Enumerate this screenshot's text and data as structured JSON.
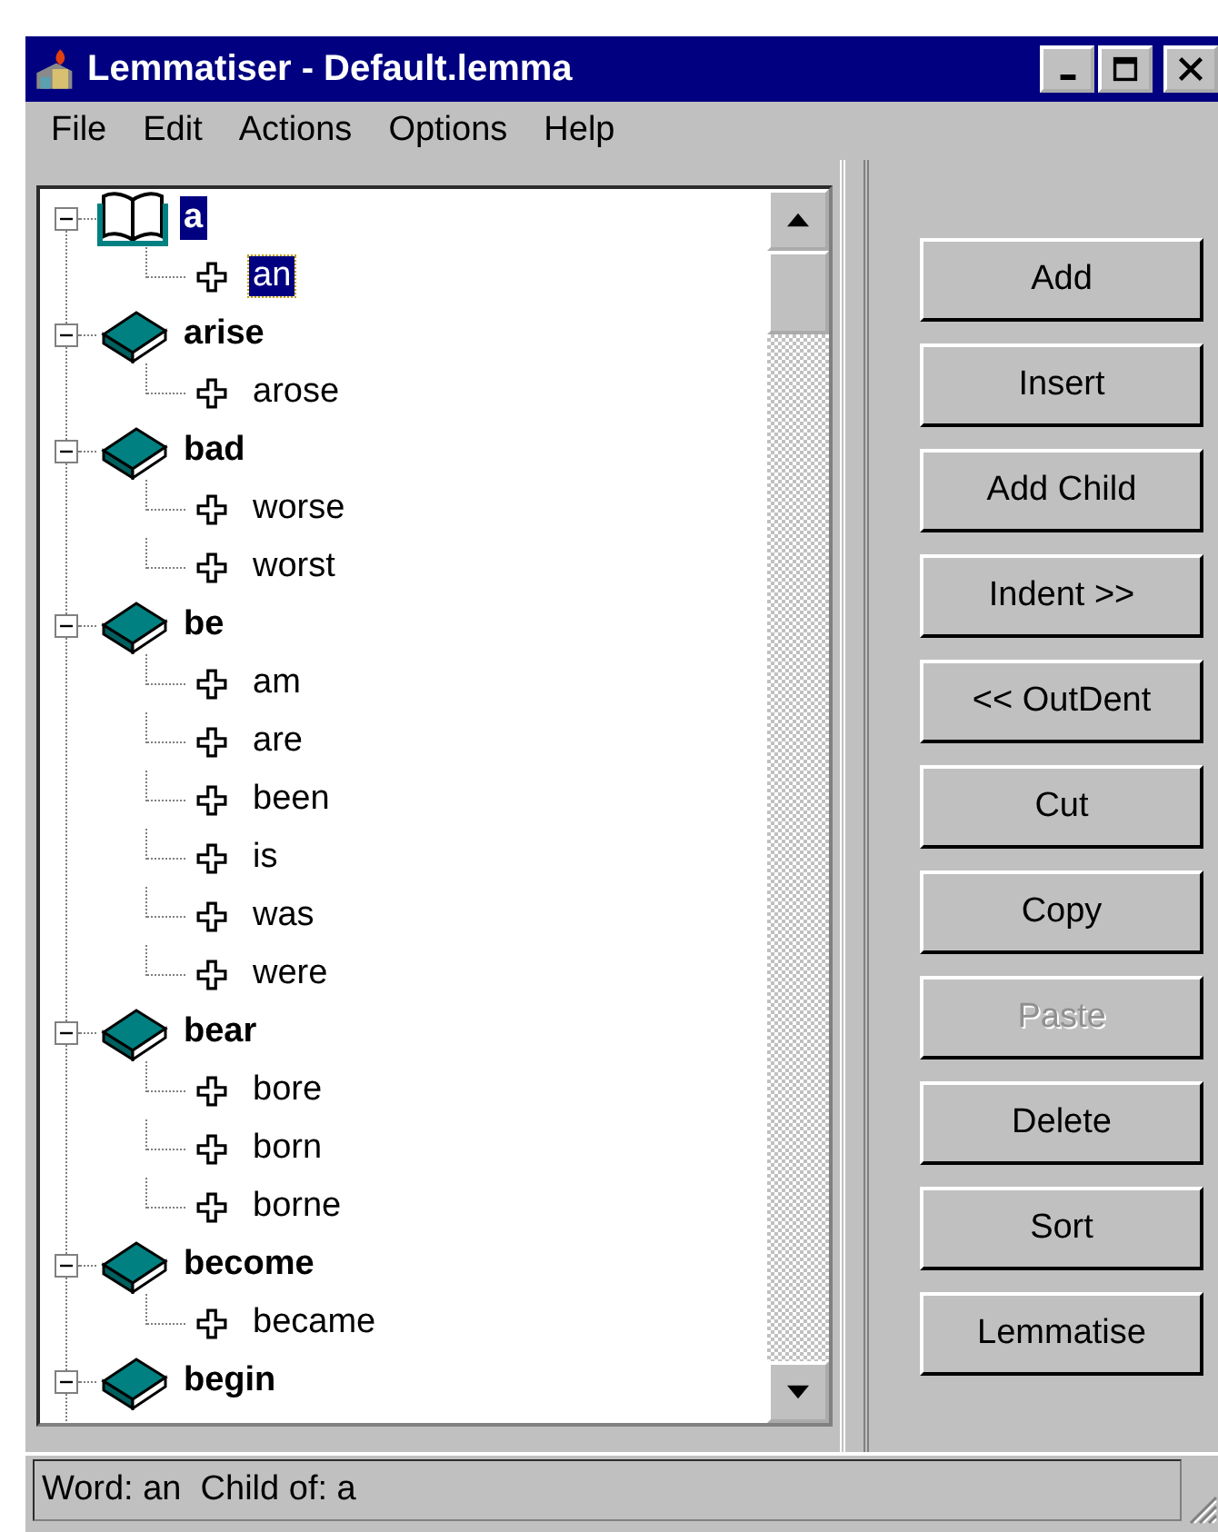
{
  "window": {
    "title": "Lemmatiser - Default.lemma"
  },
  "menu": [
    "File",
    "Edit",
    "Actions",
    "Options",
    "Help"
  ],
  "tree": [
    {
      "label": "a",
      "expanded": true,
      "open": true,
      "selected": true,
      "children": [
        {
          "label": "an",
          "selected": true
        }
      ]
    },
    {
      "label": "arise",
      "expanded": true,
      "open": false,
      "selected": false,
      "children": [
        {
          "label": "arose",
          "selected": false
        }
      ]
    },
    {
      "label": "bad",
      "expanded": true,
      "open": false,
      "selected": false,
      "children": [
        {
          "label": "worse",
          "selected": false
        },
        {
          "label": "worst",
          "selected": false
        }
      ]
    },
    {
      "label": "be",
      "expanded": true,
      "open": false,
      "selected": false,
      "children": [
        {
          "label": "am",
          "selected": false
        },
        {
          "label": "are",
          "selected": false
        },
        {
          "label": "been",
          "selected": false
        },
        {
          "label": "is",
          "selected": false
        },
        {
          "label": "was",
          "selected": false
        },
        {
          "label": "were",
          "selected": false
        }
      ]
    },
    {
      "label": "bear",
      "expanded": true,
      "open": false,
      "selected": false,
      "children": [
        {
          "label": "bore",
          "selected": false
        },
        {
          "label": "born",
          "selected": false
        },
        {
          "label": "borne",
          "selected": false
        }
      ]
    },
    {
      "label": "become",
      "expanded": true,
      "open": false,
      "selected": false,
      "children": [
        {
          "label": "became",
          "selected": false
        }
      ]
    },
    {
      "label": "begin",
      "expanded": true,
      "open": false,
      "selected": false
    }
  ],
  "buttons": [
    {
      "label": "Add",
      "disabled": false
    },
    {
      "label": "Insert",
      "disabled": false
    },
    {
      "label": "Add Child",
      "disabled": false
    },
    {
      "label": "Indent >>",
      "disabled": false
    },
    {
      "label": "<< OutDent",
      "disabled": false
    },
    {
      "label": "Cut",
      "disabled": false
    },
    {
      "label": "Copy",
      "disabled": false
    },
    {
      "label": "Paste",
      "disabled": true
    },
    {
      "label": "Delete",
      "disabled": false
    },
    {
      "label": "Sort",
      "disabled": false
    },
    {
      "label": "Lemmatise",
      "disabled": false
    }
  ],
  "status_bar": "Word: an  Child of: a"
}
